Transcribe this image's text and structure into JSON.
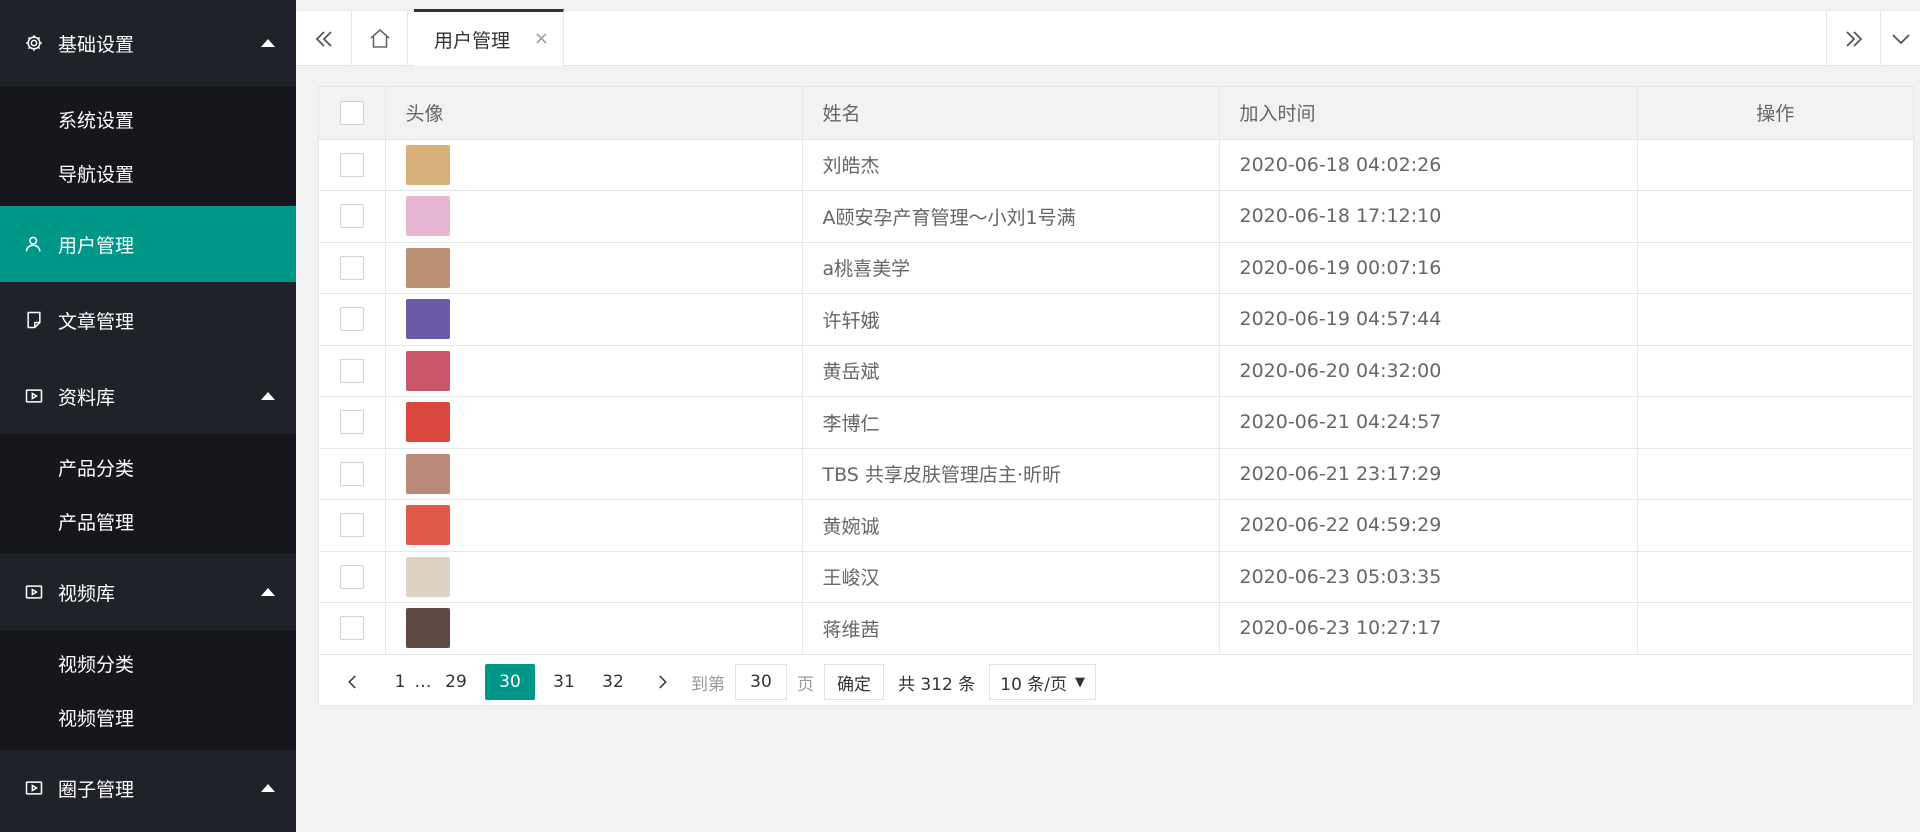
{
  "sidebar": {
    "groups": [
      {
        "label": "基础设置",
        "icon": "gear-icon",
        "items": [
          "系统设置",
          "导航设置"
        ]
      },
      {
        "label": "用户管理",
        "icon": "user-icon",
        "active": true
      },
      {
        "label": "文章管理",
        "icon": "document-icon"
      },
      {
        "label": "资料库",
        "icon": "video-icon",
        "items": [
          "产品分类",
          "产品管理"
        ]
      },
      {
        "label": "视频库",
        "icon": "video-icon",
        "items": [
          "视频分类",
          "视频管理"
        ]
      },
      {
        "label": "圈子管理",
        "icon": "video-icon"
      }
    ]
  },
  "tabs": {
    "active_label": "用户管理",
    "close_glyph": "×"
  },
  "table": {
    "headers": {
      "avatar": "头像",
      "name": "姓名",
      "joined": "加入时间",
      "actions": "操作"
    },
    "rows": [
      {
        "name": "刘皓杰",
        "joined": "2020-06-18 04:02:26",
        "avatar_color": "#d8b07a"
      },
      {
        "name": "A颐安孕产育管理～小刘1号满",
        "joined": "2020-06-18 17:12:10",
        "avatar_color": "#e6b6d3"
      },
      {
        "name": "a桃喜美学",
        "joined": "2020-06-19 00:07:16",
        "avatar_color": "#b99073"
      },
      {
        "name": "许轩娥",
        "joined": "2020-06-19 04:57:44",
        "avatar_color": "#6a5aa8"
      },
      {
        "name": "黄岳斌",
        "joined": "2020-06-20 04:32:00",
        "avatar_color": "#c9566a"
      },
      {
        "name": "李博仁",
        "joined": "2020-06-21 04:24:57",
        "avatar_color": "#d9473f"
      },
      {
        "name": "TBS 共享皮肤管理店主·昕昕",
        "joined": "2020-06-21 23:17:29",
        "avatar_color": "#b98a78"
      },
      {
        "name": "黄婉诚",
        "joined": "2020-06-22 04:59:29",
        "avatar_color": "#e0584a"
      },
      {
        "name": "王峻汉",
        "joined": "2020-06-23 05:03:35",
        "avatar_color": "#ddd2c4"
      },
      {
        "name": "蒋维茜",
        "joined": "2020-06-23 10:27:17",
        "avatar_color": "#5e4a43"
      }
    ]
  },
  "pager": {
    "first": "1",
    "ellipsis": "…",
    "pages": [
      "29",
      "30",
      "31",
      "32"
    ],
    "current": "30",
    "goto_label": "到第",
    "goto_value": "30",
    "page_label": "页",
    "confirm_label": "确定",
    "total_label": "共 312 条",
    "per_page": "10 条/页"
  },
  "colors": {
    "accent": "#009688",
    "sidebar_bg": "#20222a",
    "submenu_bg": "#16171c"
  }
}
